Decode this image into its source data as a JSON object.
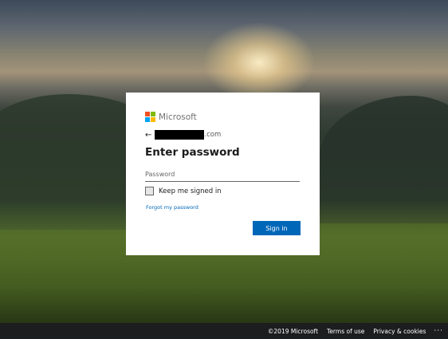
{
  "brand": {
    "name": "Microsoft",
    "logo_colors": [
      "#f25022",
      "#7fba00",
      "#00a4ef",
      "#ffb900"
    ]
  },
  "identity": {
    "back_icon": "←",
    "domain_suffix": ".com"
  },
  "form": {
    "title": "Enter password",
    "password_placeholder": "Password",
    "password_value": "",
    "keep_signed_in_label": "Keep me signed in",
    "keep_signed_in_checked": false,
    "forgot_password_link": "Forgot my password",
    "submit_label": "Sign in"
  },
  "footer": {
    "copyright": "©2019 Microsoft",
    "terms": "Terms of use",
    "privacy": "Privacy & cookies",
    "more": "···"
  },
  "colors": {
    "accent": "#0067b8",
    "footer_bg": "#1b1d1f"
  }
}
